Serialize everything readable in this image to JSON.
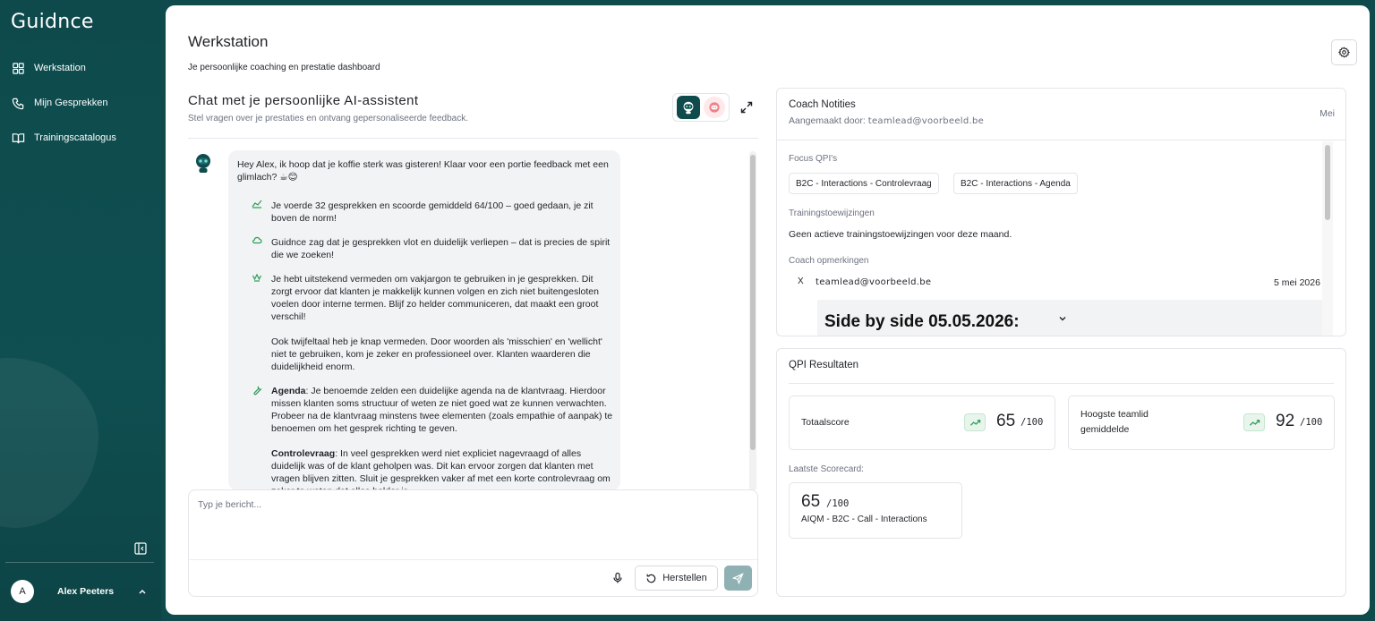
{
  "sidebar": {
    "logo": "Guidnce",
    "items": [
      {
        "label": "Werkstation",
        "icon": "dashboard-icon"
      },
      {
        "label": "Mijn Gesprekken",
        "icon": "phone-icon"
      },
      {
        "label": "Trainingscatalogus",
        "icon": "book-icon"
      }
    ],
    "user": {
      "initial": "A",
      "name": "Alex Peeters"
    }
  },
  "header": {
    "title": "Werkstation",
    "subtitle": "Je persoonlijke coaching en prestatie dashboard"
  },
  "chat": {
    "title": "Chat met je persoonlijke AI-assistent",
    "subtitle": "Stel vragen over je prestaties en ontvang gepersonaliseerde feedback.",
    "message": {
      "greeting": "Hey Alex,   ik hoop dat je koffie sterk was gisteren! Klaar voor een portie feedback met een glimlach? ☕😊",
      "items": [
        {
          "icon": "chart-icon",
          "text": "Je voerde 32 gesprekken en scoorde gemiddeld 64/100 – goed gedaan, je zit boven de norm!"
        },
        {
          "icon": "cloud-icon",
          "text": "Guidnce zag dat je gesprekken vlot en duidelijk verliepen – dat is precies de spirit die we zoeken!"
        },
        {
          "icon": "crown-icon",
          "text": "Je hebt uitstekend vermeden om vakjargon te gebruiken in je gesprekken. Dit zorgt ervoor dat klanten je makkelijk kunnen volgen en zich niet buitengesloten voelen door interne termen. Blijf zo helder communiceren, dat maakt een groot verschil!"
        },
        {
          "icon": "",
          "text": "Ook twijfeltaal heb je knap vermeden. Door woorden als 'misschien' en 'wellicht' niet te gebruiken, kom je zeker en professioneel over. Klanten waarderen die duidelijkheid enorm."
        },
        {
          "icon": "wrench-icon",
          "bold": "Agenda",
          "text": ": Je benoemde zelden een duidelijke agenda na de klantvraag. Hierdoor missen klanten soms structuur of weten ze niet goed wat ze kunnen verwachten. Probeer na de klantvraag minstens twee elementen (zoals empathie of aanpak) te benoemen om het gesprek richting te geven."
        },
        {
          "icon": "",
          "bold": "Controlevraag",
          "text": ": In veel gesprekken werd niet expliciet nagevraagd of alles duidelijk was of de klant geholpen was. Dit kan ervoor zorgen dat klanten met vragen blijven zitten. Sluit je gesprekken vaker af met een korte controlevraag om zeker te weten dat alles helder is."
        }
      ]
    },
    "input": {
      "placeholder": "Typ je bericht...",
      "value": ""
    },
    "reset_label": "Herstellen"
  },
  "coach_notes": {
    "title": "Coach Notities",
    "created_by_label": "Aangemaakt door:",
    "created_by_email": "teamlead@voorbeeld.be",
    "month": "Mei",
    "focus_label": "Focus QPI's",
    "focus_tags": [
      "B2C - Interactions - Controlevraag",
      "B2C - Interactions - Agenda"
    ],
    "training_label": "Trainingstoewijzingen",
    "training_text": "Geen actieve trainingstoewijzingen voor deze maand.",
    "remarks_label": "Coach opmerkingen",
    "remark": {
      "marker": "X",
      "author": "teamlead@voorbeeld.be",
      "date": "5 mei 2026",
      "heading": "Side by side 05.05.2026:"
    }
  },
  "qpi": {
    "title": "QPI Resultaten",
    "total": {
      "label": "Totaalscore",
      "value": "65",
      "max": "/100"
    },
    "team": {
      "label_line1": "Hoogste teamlid",
      "label_line2": "gemiddelde",
      "value": "92",
      "max": "/100"
    },
    "last_label": "Laatste Scorecard:",
    "last": {
      "value": "65",
      "max": "/100",
      "name": "AIQM - B2C - Call - Interactions"
    }
  },
  "colors": {
    "brand": "#0f4a4c",
    "send_disabled": "#8fb1b3",
    "trend_green": "#2e9d57"
  }
}
